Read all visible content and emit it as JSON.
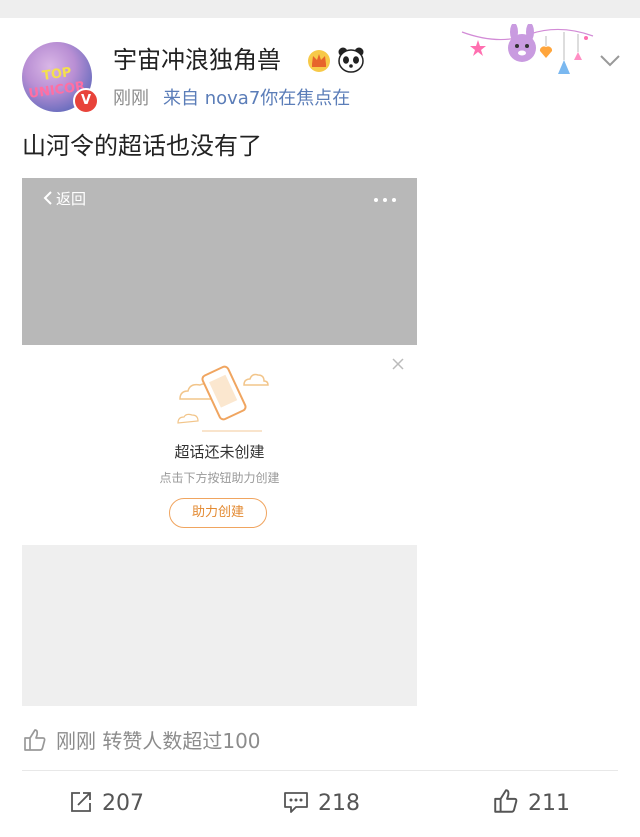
{
  "post": {
    "author": "宇宙冲浪独角兽",
    "avatar_text_line1": "TOP",
    "avatar_text_line2": "UNICOR",
    "verified_badge": "V",
    "time": "刚刚",
    "source": "来自 nova7你在焦点在",
    "text": "山河令的超话也没有了",
    "badges": [
      "crown-icon",
      "panda-icon"
    ]
  },
  "screenshot": {
    "back_label": "返回",
    "empty_title": "超话还未创建",
    "empty_subtitle": "点击下方按钮助力创建",
    "help_button_label": "助力创建"
  },
  "like_stat": "刚刚 转赞人数超过100",
  "actions": {
    "repost_count": "207",
    "comment_count": "218",
    "like_count": "211"
  },
  "colors": {
    "accent_orange": "#e38a32",
    "verified_red": "#e8433a",
    "source_blue": "#5b7db8"
  }
}
